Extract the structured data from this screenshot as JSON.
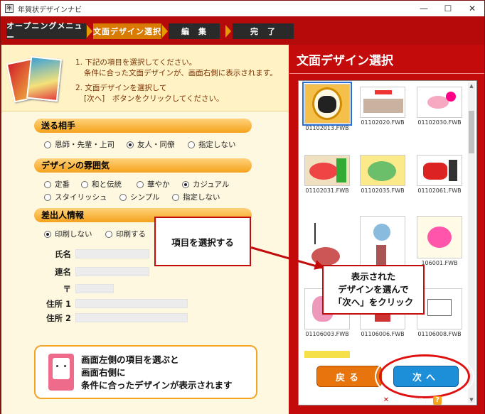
{
  "window": {
    "title": "年賀状デザインナビ",
    "controls": {
      "minimize": "—",
      "maximize": "☐",
      "close": "✕"
    }
  },
  "steps": [
    "オープニングメニュー",
    "文面デザイン選択",
    "編　集",
    "完　了"
  ],
  "active_step_index": 1,
  "instructions": {
    "line1": "1. 下記の項目を選択してください。",
    "line2": "条件に合った文面デザインが、画面右側に表示されます。",
    "line3": "2. 文面デザインを選択して",
    "line4": "[次へ]　ボタンをクリックしてください。"
  },
  "send_to": {
    "header": "送る相手",
    "options": [
      "恩師・先輩・上司",
      "友人・同僚",
      "指定しない"
    ],
    "selected": "友人・同僚"
  },
  "atmosphere": {
    "header": "デザインの雰囲気",
    "options_row1": [
      "定番",
      "和と伝統",
      "華やか",
      "カジュアル"
    ],
    "options_row2": [
      "スタイリッシュ",
      "シンプル",
      "指定しない"
    ],
    "selected": "カジュアル"
  },
  "sender": {
    "header": "差出人情報",
    "options": [
      "印刷しない",
      "印刷する"
    ],
    "selected": "印刷しない",
    "fields": {
      "name": "氏名",
      "company": "連名",
      "postal": "〒",
      "address1": "住所 1",
      "address2": "住所 2"
    }
  },
  "tip": {
    "line1": "画面左側の項目を選ぶと",
    "line2": "画面右側に",
    "line3": "条件に合ったデザインが表示されます"
  },
  "right_panel": {
    "title": "文面デザイン選択",
    "thumbnails": [
      "01102013.FWB",
      "01102020.FWB",
      "01102030.FWB",
      "01102031.FWB",
      "01102035.FWB",
      "01102061.FWB",
      "",
      "",
      "106001.FWB",
      "01106003.FWB",
      "01106006.FWB",
      "01106008.FWB"
    ],
    "selected_index": 0
  },
  "buttons": {
    "back": "戻る",
    "next": "次へ"
  },
  "footer": {
    "cancel": "キャンセル",
    "help": "ヘルプ"
  },
  "callouts": {
    "left": "項目を選択する",
    "right_line1": "表示された",
    "right_line2": "デザインを選んで",
    "right_line3": "「次へ」をクリック"
  },
  "colors": {
    "brand_red": "#c40b0b",
    "active_step": "#d97b00",
    "next_button": "#1d8fd8",
    "back_button": "#e8740e",
    "section_header": "#f5a21c"
  }
}
